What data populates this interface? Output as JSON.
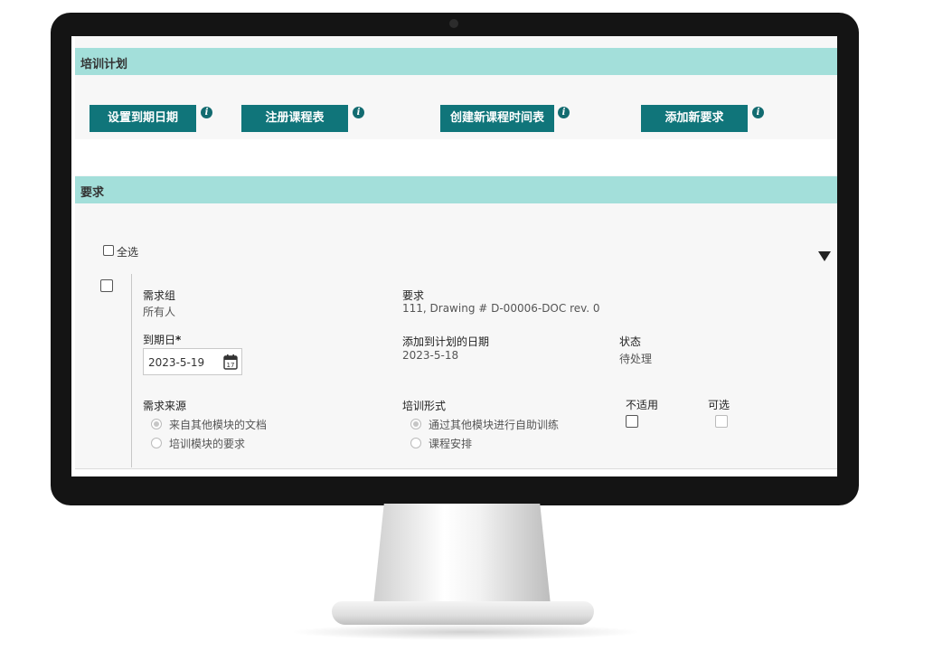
{
  "training_plan": {
    "title": "培训计划",
    "buttons": {
      "set_due_date": "设置到期日期",
      "register_schedule": "注册课程表",
      "create_schedule": "创建新课程时间表",
      "add_requirement": "添加新要求"
    },
    "info_glyph": "i"
  },
  "requirements": {
    "title": "要求",
    "select_all": "全选",
    "row": {
      "group_label": "需求组",
      "group_value": "所有人",
      "requirement_label": "要求",
      "requirement_value": "111, Drawing # D-00006-DOC rev. 0",
      "due_date_label": "到期日",
      "required_mark": "*",
      "due_date_value": "2023-5-19",
      "calendar_day": "17",
      "added_date_label": "添加到计划的日期",
      "added_date_value": "2023-5-18",
      "status_label": "状态",
      "status_value": "待处理",
      "source_label": "需求来源",
      "source_options": [
        "来自其他模块的文档",
        "培训模块的要求"
      ],
      "format_label": "培训形式",
      "format_options": [
        "通过其他模块进行自助训练",
        "课程安排"
      ],
      "not_applicable_label": "不适用",
      "optional_label": "可选"
    }
  },
  "colors": {
    "section_bar": "#a3dfda",
    "button": "#10757a",
    "bezel": "#141414"
  }
}
